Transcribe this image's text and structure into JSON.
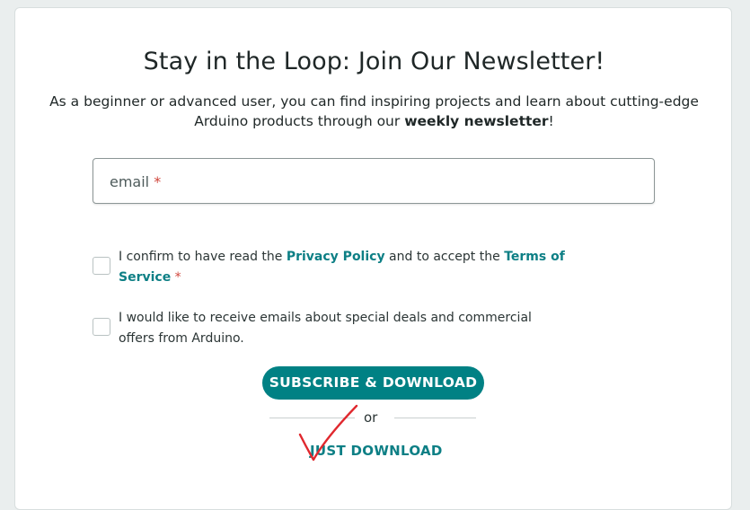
{
  "newsletter": {
    "title": "Stay in the Loop: Join Our Newsletter!",
    "subtitle_part1": "As a beginner or advanced user, you can find inspiring projects and learn about cutting-edge Arduino products through our ",
    "subtitle_bold": "weekly newsletter",
    "subtitle_part2": "!"
  },
  "email": {
    "placeholder": "email",
    "required_mark": "*"
  },
  "consent": {
    "text1": "I confirm to have read the ",
    "privacy_link": "Privacy Policy",
    "text2": " and to accept the ",
    "terms_link": "Terms of Service",
    "required_mark": "*"
  },
  "marketing": {
    "text": "I would like to receive emails about special deals and commercial offers from Arduino."
  },
  "actions": {
    "subscribe_label": "SUBSCRIBE & DOWNLOAD",
    "or_label": "or",
    "just_download_label": "JUST DOWNLOAD"
  },
  "colors": {
    "accent": "#008184",
    "link": "#0d7f85",
    "required": "#d0463c",
    "annotation": "#e0282e"
  }
}
